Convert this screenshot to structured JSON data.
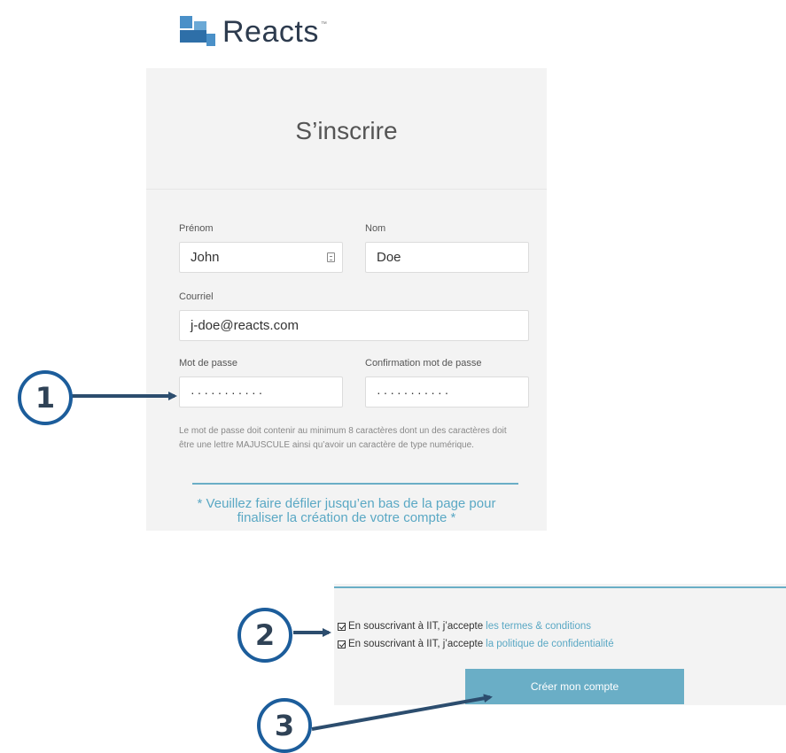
{
  "brand": {
    "name": "Reacts",
    "tm": "™"
  },
  "signup": {
    "title": "S’inscrire",
    "first_name": {
      "label": "Prénom",
      "value": "John"
    },
    "last_name": {
      "label": "Nom",
      "value": "Doe"
    },
    "email": {
      "label": "Courriel",
      "value": "j-doe@reacts.com"
    },
    "password": {
      "label": "Mot de passe",
      "value": "···········"
    },
    "password_confirm": {
      "label": "Confirmation mot de passe",
      "value": "···········"
    },
    "hint_line1": "Le mot de passe doit contenir au minimum 8 caractères dont un des caractères doit",
    "hint_line2": "être une lettre MAJUSCULE ainsi qu’avoir un caractère de type numérique.",
    "scroll_note_line1": "* Veuillez faire défiler jusqu’en bas de la page pour",
    "scroll_note_line2": "finaliser la création de votre compte *"
  },
  "consent": {
    "terms_prefix": "En souscrivant à IIT, j’accepte",
    "terms_link": "les termes & conditions",
    "privacy_prefix": "En souscrivant à IIT, j’accepte",
    "privacy_link": "la politique de confidentialité",
    "terms_checked": true,
    "privacy_checked": true,
    "create_button": "Créer mon compte"
  },
  "callouts": {
    "one": "1",
    "two": "2",
    "three": "3"
  },
  "colors": {
    "accent": "#6aaec6",
    "callout_border": "#1c5d9b",
    "arrow": "#2c4d6e",
    "logo": "#2d3b4e"
  },
  "icons": {
    "logo": "reacts-logo-icon",
    "field_badge": "keyboard-icon",
    "check": "checkbox-checked-icon"
  }
}
